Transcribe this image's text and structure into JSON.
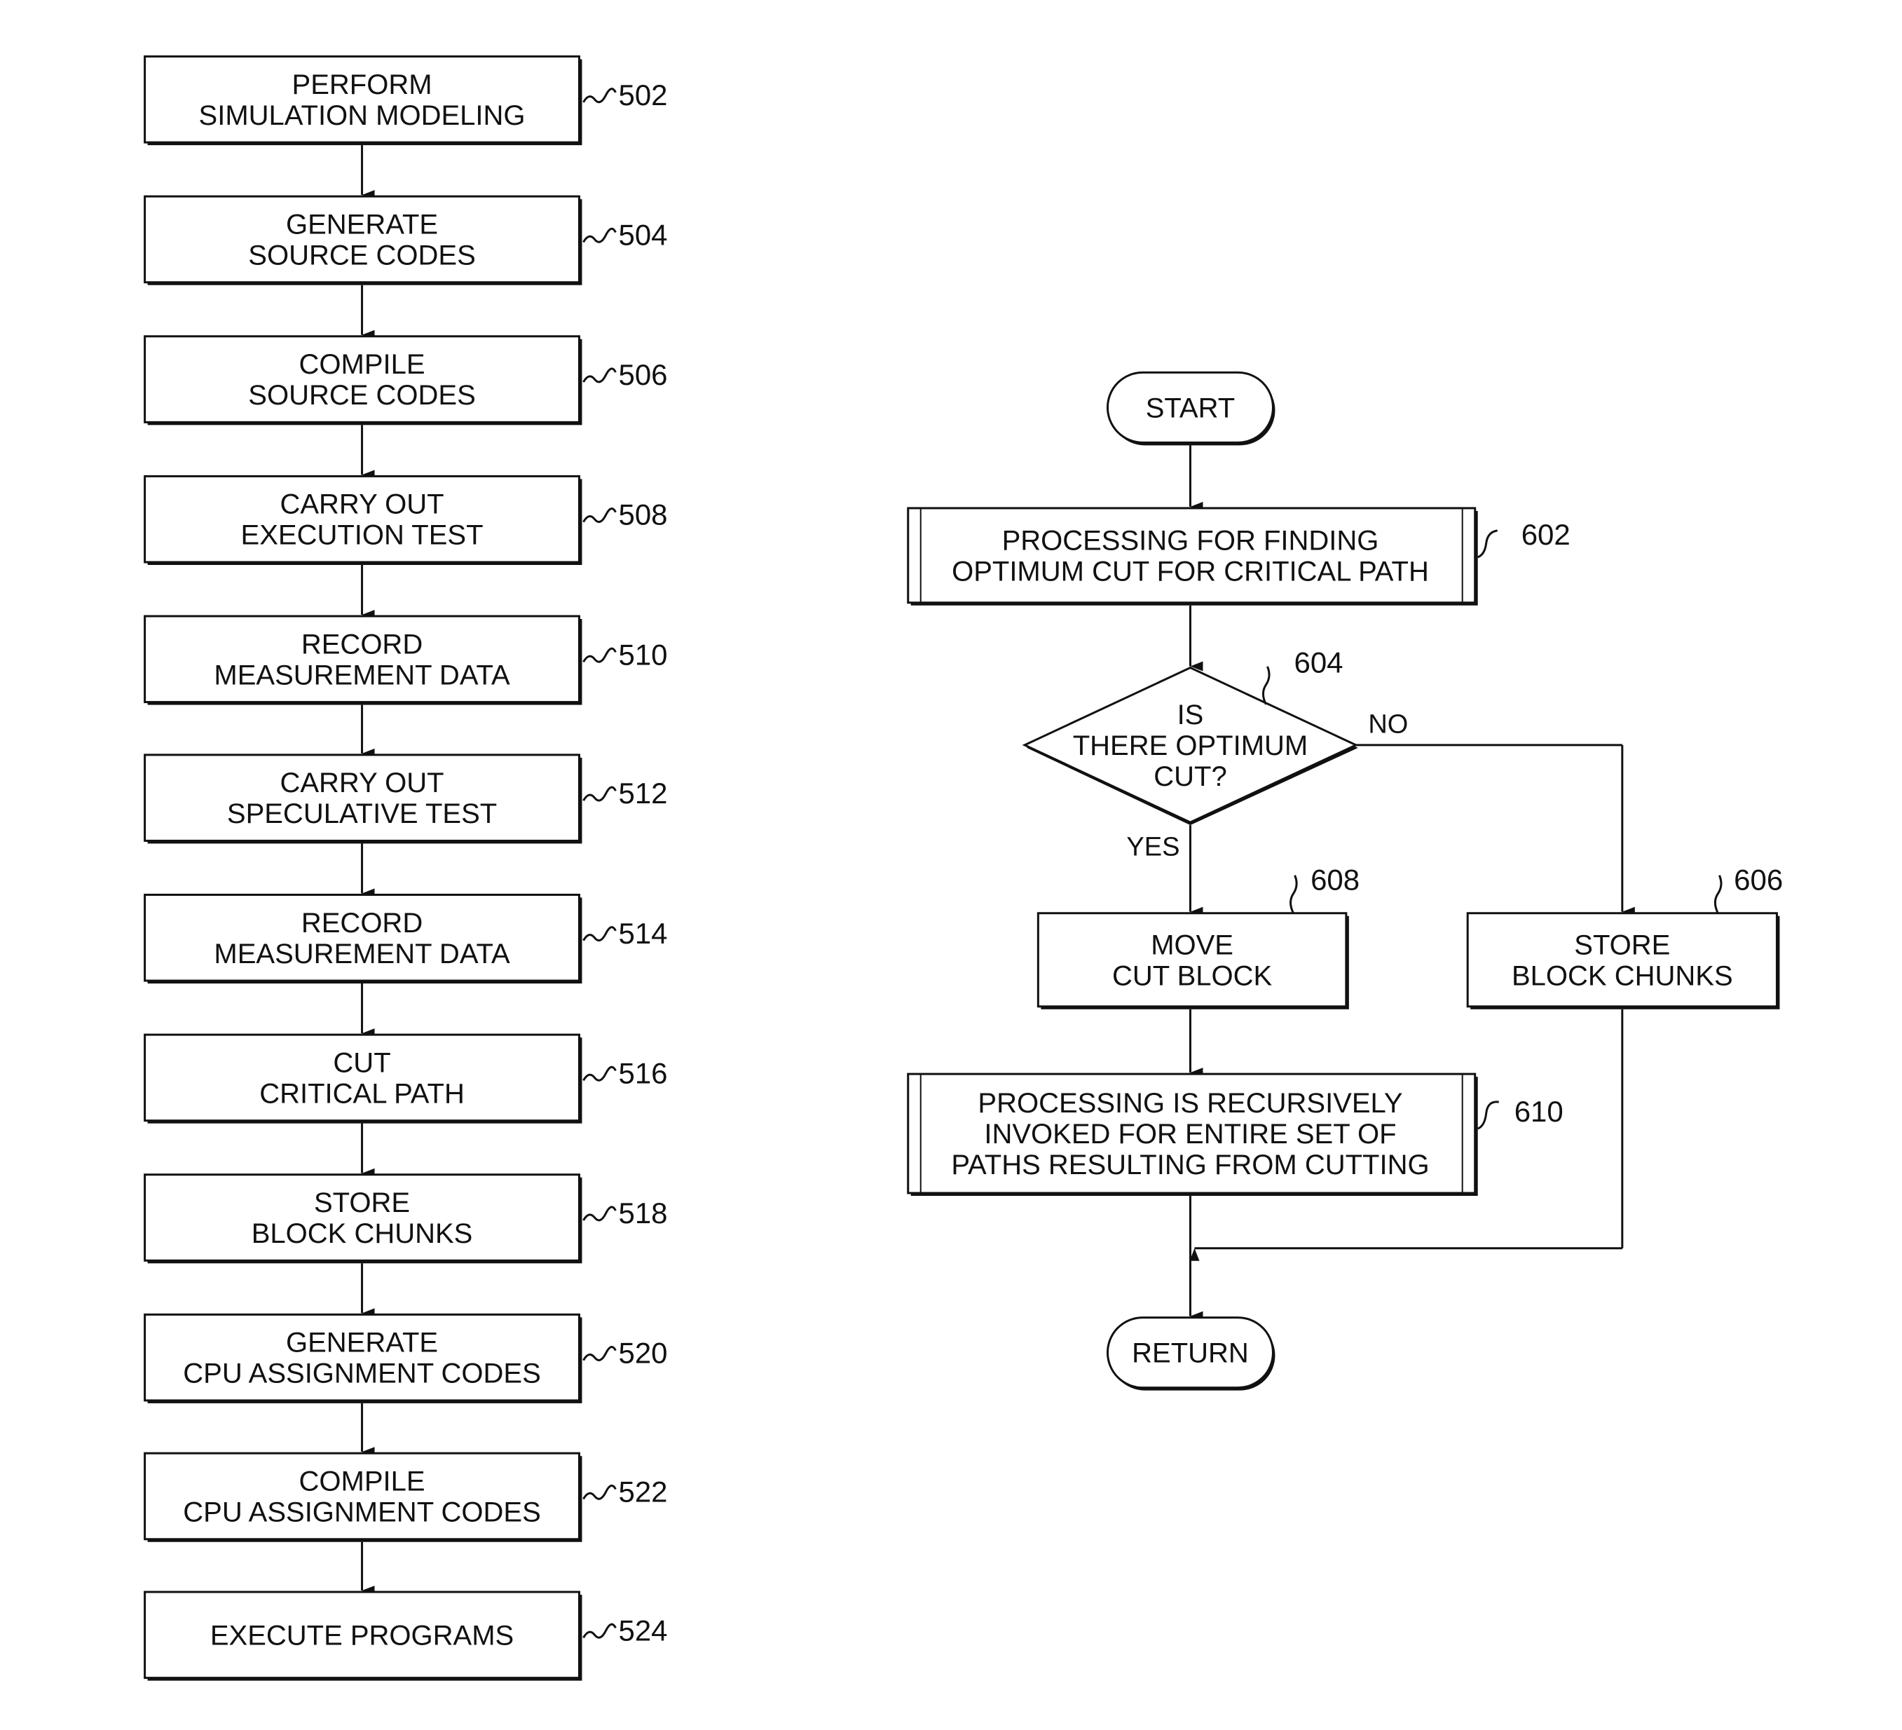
{
  "figure_left": {
    "steps": [
      {
        "ref": "502",
        "lines": [
          "PERFORM",
          "SIMULATION MODELING"
        ]
      },
      {
        "ref": "504",
        "lines": [
          "GENERATE",
          "SOURCE CODES"
        ]
      },
      {
        "ref": "506",
        "lines": [
          "COMPILE",
          "SOURCE CODES"
        ]
      },
      {
        "ref": "508",
        "lines": [
          "CARRY OUT",
          "EXECUTION TEST"
        ]
      },
      {
        "ref": "510",
        "lines": [
          "RECORD",
          "MEASUREMENT DATA"
        ]
      },
      {
        "ref": "512",
        "lines": [
          "CARRY OUT",
          "SPECULATIVE TEST"
        ]
      },
      {
        "ref": "514",
        "lines": [
          "RECORD",
          "MEASUREMENT DATA"
        ]
      },
      {
        "ref": "516",
        "lines": [
          "CUT",
          "CRITICAL PATH"
        ]
      },
      {
        "ref": "518",
        "lines": [
          "STORE",
          "BLOCK CHUNKS"
        ]
      },
      {
        "ref": "520",
        "lines": [
          "GENERATE",
          "CPU ASSIGNMENT CODES"
        ]
      },
      {
        "ref": "522",
        "lines": [
          "COMPILE",
          "CPU ASSIGNMENT CODES"
        ]
      },
      {
        "ref": "524",
        "lines": [
          "EXECUTE PROGRAMS"
        ]
      }
    ]
  },
  "figure_right": {
    "start": "START",
    "return": "RETURN",
    "process_602": {
      "ref": "602",
      "lines": [
        "PROCESSING FOR FINDING",
        "OPTIMUM CUT FOR CRITICAL PATH"
      ]
    },
    "decision_604": {
      "ref": "604",
      "lines": [
        "IS",
        "THERE OPTIMUM",
        "CUT?"
      ],
      "yes_label": "YES",
      "no_label": "NO"
    },
    "step_608": {
      "ref": "608",
      "lines": [
        "MOVE",
        "CUT BLOCK"
      ]
    },
    "step_606": {
      "ref": "606",
      "lines": [
        "STORE",
        "BLOCK CHUNKS"
      ]
    },
    "process_610": {
      "ref": "610",
      "lines": [
        "PROCESSING IS RECURSIVELY",
        "INVOKED FOR ENTIRE SET OF",
        "PATHS RESULTING FROM CUTTING"
      ]
    }
  }
}
